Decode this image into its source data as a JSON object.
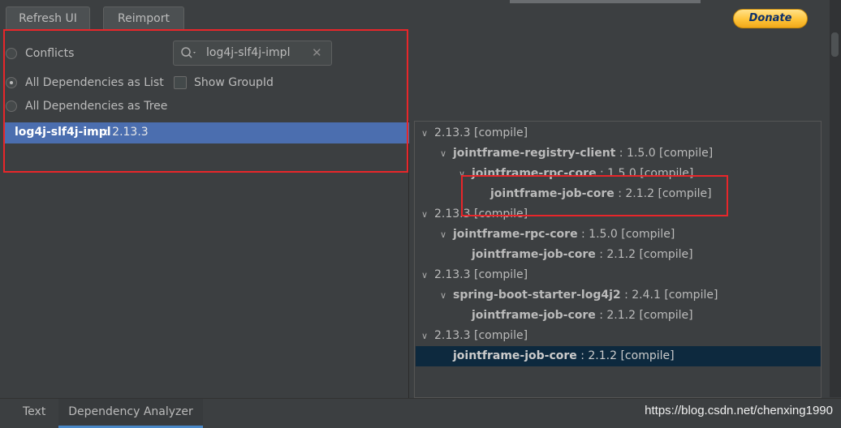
{
  "toolbar": {
    "refresh_label": "Refresh UI",
    "reimport_label": "Reimport",
    "donate_label": "Donate"
  },
  "filters": {
    "conflicts_label": "Conflicts",
    "all_list_label": "All Dependencies as List",
    "all_tree_label": "All Dependencies as Tree",
    "show_groupid_label": "Show GroupId",
    "selected_mode": "All Dependencies as List"
  },
  "search": {
    "value": "log4j-slf4j-impl"
  },
  "left_list": [
    {
      "name": "log4j-slf4j-impl",
      "version": " : 2.13.3"
    }
  ],
  "tree": [
    {
      "depth": 0,
      "expanded": true,
      "name": "",
      "version": "2.13.3 [compile]"
    },
    {
      "depth": 1,
      "expanded": true,
      "name": "jointframe-registry-client",
      "version": " : 1.5.0 [compile]"
    },
    {
      "depth": 2,
      "expanded": true,
      "name": "jointframe-rpc-core",
      "version": " : 1.5.0 [compile]"
    },
    {
      "depth": 3,
      "expanded": null,
      "name": "jointframe-job-core",
      "version": " : 2.1.2 [compile]"
    },
    {
      "depth": 0,
      "expanded": true,
      "name": "",
      "version": "2.13.3 [compile]"
    },
    {
      "depth": 1,
      "expanded": true,
      "name": "jointframe-rpc-core",
      "version": " : 1.5.0 [compile]"
    },
    {
      "depth": 2,
      "expanded": null,
      "name": "jointframe-job-core",
      "version": " : 2.1.2 [compile]"
    },
    {
      "depth": 0,
      "expanded": true,
      "name": "",
      "version": "2.13.3 [compile]"
    },
    {
      "depth": 1,
      "expanded": true,
      "name": "spring-boot-starter-log4j2",
      "version": " : 2.4.1 [compile]"
    },
    {
      "depth": 2,
      "expanded": null,
      "name": "jointframe-job-core",
      "version": " : 2.1.2 [compile]"
    },
    {
      "depth": 0,
      "expanded": true,
      "name": "",
      "version": "2.13.3 [compile]"
    },
    {
      "depth": 1,
      "expanded": null,
      "name": "jointframe-job-core",
      "version": " : 2.1.2 [compile]",
      "highlighted": true
    }
  ],
  "tabs": {
    "text_label": "Text",
    "analyzer_label": "Dependency Analyzer"
  },
  "watermark": "https://blog.csdn.net/chenxing1990",
  "colors": {
    "background": "#3c3f41",
    "selection": "#4b6eaf",
    "tree_highlight": "#0d293e",
    "annotation_red": "#e8262a"
  }
}
